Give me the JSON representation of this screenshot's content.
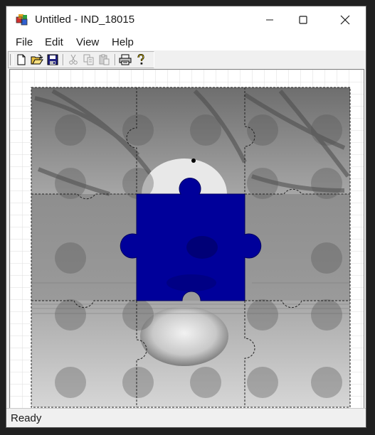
{
  "window": {
    "title": "Untitled - IND_18015",
    "icon": "puzzle-app-icon",
    "controls": [
      "minimize-icon",
      "maximize-icon",
      "close-icon"
    ]
  },
  "menu": {
    "file": "File",
    "edit": "Edit",
    "view": "View",
    "help": "Help"
  },
  "toolbar": {
    "buttons": [
      {
        "icon": "new-document-icon",
        "enabled": true
      },
      {
        "icon": "open-folder-icon",
        "enabled": true
      },
      {
        "icon": "save-disk-icon",
        "enabled": true
      },
      {
        "icon": "cut-scissors-icon",
        "enabled": false
      },
      {
        "icon": "copy-icon",
        "enabled": false
      },
      {
        "icon": "paste-icon",
        "enabled": false
      },
      {
        "icon": "print-icon",
        "enabled": true
      },
      {
        "icon": "help-question-icon",
        "enabled": true
      }
    ]
  },
  "puzzle": {
    "rows": 3,
    "cols": 3,
    "selected_piece": {
      "row": 1,
      "col": 1
    },
    "selected_color": "#00009a",
    "image_description_color": "#8c8c8c"
  },
  "status": {
    "text": "Ready"
  }
}
